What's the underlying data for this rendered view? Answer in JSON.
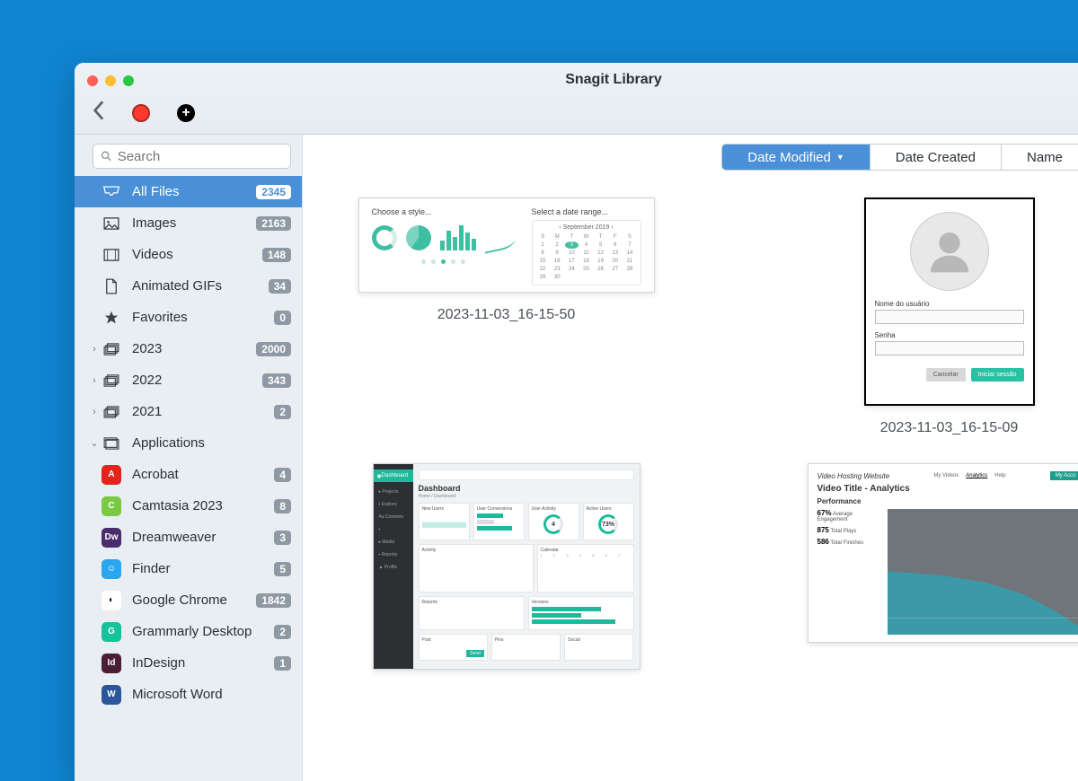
{
  "window_title": "Snagit Library",
  "search_placeholder": "Search",
  "sort": {
    "date_modified": "Date Modified",
    "date_created": "Date Created",
    "name": "Name"
  },
  "sidebar": {
    "categories": [
      {
        "label": "All Files",
        "count": "2345"
      },
      {
        "label": "Images",
        "count": "2163"
      },
      {
        "label": "Videos",
        "count": "148"
      },
      {
        "label": "Animated GIFs",
        "count": "34"
      },
      {
        "label": "Favorites",
        "count": "0"
      }
    ],
    "years": [
      {
        "label": "2023",
        "count": "2000"
      },
      {
        "label": "2022",
        "count": "343"
      },
      {
        "label": "2021",
        "count": "2"
      }
    ],
    "applications_label": "Applications",
    "applications": [
      {
        "label": "Acrobat",
        "count": "4",
        "color": "#e1251b",
        "abbr": "A"
      },
      {
        "label": "Camtasia 2023",
        "count": "8",
        "color": "#7ac943",
        "abbr": "C"
      },
      {
        "label": "Dreamweaver",
        "count": "3",
        "color": "#4b2d6f",
        "abbr": "Dw"
      },
      {
        "label": "Finder",
        "count": "5",
        "color": "#2aa6f0",
        "abbr": "☺"
      },
      {
        "label": "Google Chrome",
        "count": "1842",
        "color": "#fff",
        "abbr": "◐"
      },
      {
        "label": "Grammarly Desktop",
        "count": "2",
        "color": "#15c39a",
        "abbr": "G"
      },
      {
        "label": "InDesign",
        "count": "1",
        "color": "#4b1e36",
        "abbr": "Id"
      },
      {
        "label": "Microsoft Word",
        "count": "",
        "color": "#2b579a",
        "abbr": "W"
      }
    ]
  },
  "thumbnails": {
    "t1": {
      "caption": "2023-11-03_16-15-50",
      "left_title": "Choose a style...",
      "right_title": "Select a date range...",
      "cal_month": "September 2019"
    },
    "t2": {
      "caption": "2023-11-03_16-15-09",
      "user_label": "Nome do usuário",
      "pass_label": "Senha",
      "cancel": "Cancelar",
      "login": "Iniciar sessão"
    },
    "t3": {
      "dash_title": "Dashboard",
      "breadcrumb": "Home / Dashboard",
      "sb_top": "Dashboard",
      "cards": {
        "new_users": "New Users",
        "conversions": "User Conversions",
        "activity": "User Activity",
        "active": "Active Users",
        "v1": "4",
        "v2": "73%"
      },
      "sections": {
        "activity": "Activity",
        "calendar": "Calendar",
        "reports": "Reports",
        "versions": "Versions",
        "post": "Post",
        "pins": "Pins",
        "social": "Social"
      }
    },
    "t4": {
      "site": "Video Hosting Website",
      "nav": {
        "videos": "My Videos",
        "analytics": "Analytics",
        "help": "Help",
        "account": "My Acco"
      },
      "title": "Video Title - Analytics",
      "perf": "Performance",
      "stats": {
        "s1n": "67%",
        "s1l": "Average Engagement",
        "s2n": "875",
        "s2l": "Total Plays",
        "s3n": "586",
        "s3l": "Total Finishes"
      }
    }
  }
}
